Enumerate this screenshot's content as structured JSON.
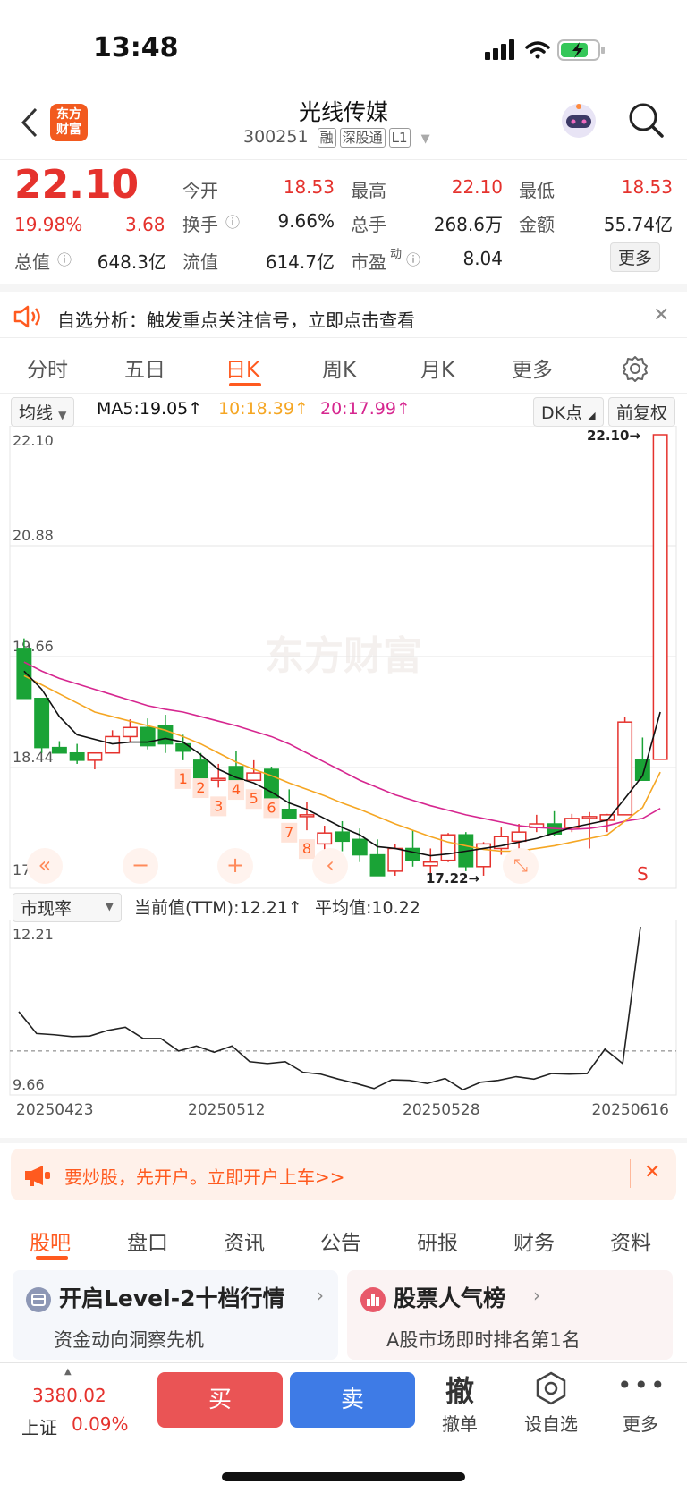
{
  "status": {
    "time": "13:48"
  },
  "header": {
    "logo_text": [
      "东方",
      "财富"
    ],
    "title": "光线传媒",
    "code": "300251",
    "tags": [
      "融",
      "深股通",
      "L1"
    ]
  },
  "quote": {
    "price": "22.10",
    "change_pct": "19.98%",
    "change": "3.68",
    "fields": [
      {
        "label": "今开",
        "value": "18.53",
        "color": "#e5322d"
      },
      {
        "label": "最高",
        "value": "22.10",
        "color": "#e5322d"
      },
      {
        "label": "最低",
        "value": "18.53",
        "color": "#e5322d"
      },
      {
        "label": "换手",
        "value": "9.66%",
        "color": "#222"
      },
      {
        "label": "总手",
        "value": "268.6万",
        "color": "#222"
      },
      {
        "label": "金额",
        "value": "55.74亿",
        "color": "#222"
      },
      {
        "label": "总值",
        "value": "648.3亿",
        "color": "#222"
      },
      {
        "label": "流值",
        "value": "614.7亿",
        "color": "#222"
      },
      {
        "label": "市盈",
        "value": "8.04",
        "color": "#222"
      }
    ],
    "pe_superscript": "动",
    "more_label": "更多"
  },
  "banner": {
    "text": "自选分析：触发重点关注信号，立即点击查看"
  },
  "tabs": [
    "分时",
    "五日",
    "日K",
    "周K",
    "月K",
    "更多"
  ],
  "active_tab": "日K",
  "ma": {
    "selector": "均线",
    "ma5": "MA5:19.05",
    "ma10": "10:18.39",
    "ma20": "20:17.99",
    "dk_label": "DK点",
    "adjust_label": "前复权"
  },
  "indicator": {
    "selector": "市现率",
    "current": "当前值(TTM):12.21",
    "average": "平均值:10.22"
  },
  "watermark": "东方财富",
  "ad": {
    "text": "要炒股，先开户。立即开户上车>>"
  },
  "subtabs": [
    "股吧",
    "盘口",
    "资讯",
    "公告",
    "研报",
    "财务",
    "资料"
  ],
  "cards": [
    {
      "title": "开启Level-2十档行情",
      "subtitle": "资金动向洞察先机"
    },
    {
      "title": "股票人气榜",
      "subtitle": "A股市场即时排名第1名"
    }
  ],
  "bottom": {
    "index_value": "3380.02",
    "index_name": "上证",
    "index_pct": "0.09%",
    "buy": "买",
    "sell": "卖",
    "cancel_glyph": "撤",
    "cancel": "撤单",
    "watch": "设自选",
    "more": "更多"
  },
  "colors": {
    "up": "#e5322d",
    "down": "#1aa336",
    "accent": "#ff5a1f",
    "ma5": "#111111",
    "ma10": "#f5a623",
    "ma20": "#d6268f"
  },
  "chart_data": [
    {
      "type": "candlestick",
      "y_axis_labels": [
        "22.10",
        "20.88",
        "19.66",
        "18.44",
        "17.22"
      ],
      "ylim": [
        17.22,
        22.1
      ],
      "ohlc": [
        [
          19.75,
          19.86,
          19.2,
          19.2
        ],
        [
          19.2,
          19.2,
          18.6,
          18.66
        ],
        [
          18.66,
          18.73,
          18.6,
          18.6
        ],
        [
          18.6,
          18.7,
          18.48,
          18.52
        ],
        [
          18.52,
          18.6,
          18.42,
          18.6
        ],
        [
          18.6,
          18.85,
          18.6,
          18.78
        ],
        [
          18.78,
          18.97,
          18.72,
          18.88
        ],
        [
          18.88,
          18.98,
          18.64,
          18.68
        ],
        [
          18.9,
          19.02,
          18.6,
          18.7
        ],
        [
          18.7,
          18.8,
          18.52,
          18.62
        ],
        [
          18.52,
          18.6,
          18.42,
          18.2
        ],
        [
          18.3,
          18.48,
          18.22,
          18.32
        ],
        [
          18.45,
          18.62,
          18.4,
          18.18
        ],
        [
          18.3,
          18.52,
          18.3,
          18.38
        ],
        [
          18.42,
          18.45,
          18.2,
          17.98
        ],
        [
          17.98,
          18.2,
          17.93,
          17.88
        ],
        [
          17.9,
          18.06,
          17.75,
          17.92
        ],
        [
          17.6,
          17.8,
          17.45,
          17.72
        ],
        [
          17.73,
          17.85,
          17.52,
          17.63
        ],
        [
          17.65,
          17.77,
          17.4,
          17.48
        ],
        [
          17.48,
          17.65,
          17.35,
          17.25
        ],
        [
          17.3,
          17.6,
          17.25,
          17.55
        ],
        [
          17.55,
          17.75,
          17.35,
          17.42
        ],
        [
          17.36,
          17.55,
          17.22,
          17.4
        ],
        [
          17.42,
          17.72,
          17.4,
          17.7
        ],
        [
          17.7,
          17.73,
          17.3,
          17.35
        ],
        [
          17.35,
          17.62,
          17.25,
          17.6
        ],
        [
          17.55,
          17.78,
          17.48,
          17.68
        ],
        [
          17.63,
          17.82,
          17.52,
          17.73
        ],
        [
          17.78,
          17.92,
          17.73,
          17.82
        ],
        [
          17.82,
          17.96,
          17.69,
          17.71
        ],
        [
          17.78,
          17.93,
          17.73,
          17.88
        ],
        [
          17.88,
          17.95,
          17.55,
          17.9
        ],
        [
          17.86,
          17.93,
          17.73,
          17.92
        ],
        [
          17.92,
          19.0,
          17.92,
          18.94
        ],
        [
          18.53,
          18.77,
          18.4,
          18.3
        ],
        [
          18.53,
          22.1,
          18.53,
          22.1
        ]
      ],
      "ma5": [
        19.5,
        19.3,
        19.0,
        18.8,
        18.75,
        18.7,
        18.72,
        18.72,
        18.76,
        18.72,
        18.58,
        18.42,
        18.33,
        18.27,
        18.17,
        18.05,
        17.98,
        17.88,
        17.78,
        17.7,
        17.57,
        17.55,
        17.51,
        17.47,
        17.49,
        17.52,
        17.55,
        17.58,
        17.62,
        17.66,
        17.72,
        17.78,
        17.82,
        17.86,
        18.1,
        18.35,
        19.05
      ],
      "ma10": [
        19.45,
        19.35,
        19.25,
        19.15,
        19.05,
        19.0,
        18.95,
        18.9,
        18.85,
        18.78,
        18.7,
        18.6,
        18.5,
        18.42,
        18.35,
        18.27,
        18.2,
        18.13,
        18.05,
        17.98,
        17.9,
        17.82,
        17.75,
        17.68,
        17.62,
        17.58,
        17.54,
        17.52,
        17.52,
        17.55,
        17.58,
        17.62,
        17.66,
        17.7,
        17.85,
        18.0,
        18.39
      ],
      "ma20": [
        19.6,
        19.5,
        19.42,
        19.36,
        19.3,
        19.24,
        19.18,
        19.12,
        19.08,
        19.05,
        19.0,
        18.95,
        18.9,
        18.84,
        18.78,
        18.7,
        18.6,
        18.5,
        18.4,
        18.3,
        18.22,
        18.14,
        18.08,
        18.02,
        17.97,
        17.92,
        17.88,
        17.84,
        17.8,
        17.78,
        17.77,
        17.76,
        17.77,
        17.8,
        17.85,
        17.88,
        17.99
      ],
      "up_marks": [
        {
          "i": 9,
          "text": "1"
        },
        {
          "i": 10,
          "text": "2"
        },
        {
          "i": 11,
          "text": "3"
        },
        {
          "i": 12,
          "text": "4"
        },
        {
          "i": 13,
          "text": "5"
        },
        {
          "i": 14,
          "text": "6"
        },
        {
          "i": 15,
          "text": "7"
        },
        {
          "i": 16,
          "text": "8"
        }
      ],
      "down_marks": [],
      "max_label": "22.10",
      "min_label": "17.22",
      "s_mark": "S"
    },
    {
      "type": "line",
      "series": [
        {
          "values": [
            10.85,
            10.5,
            10.48,
            10.45,
            10.46,
            10.55,
            10.6,
            10.42,
            10.42,
            10.22,
            10.3,
            10.2,
            10.3,
            10.05,
            10.02,
            10.05,
            9.88,
            9.85,
            9.77,
            9.7,
            9.62,
            9.76,
            9.75,
            9.7,
            9.78,
            9.6,
            9.72,
            9.75,
            9.81,
            9.77,
            9.86,
            9.85,
            9.86,
            10.25,
            10.02,
            12.21
          ]
        }
      ],
      "y_axis_labels": [
        "12.21",
        "9.66"
      ],
      "ylim": [
        9.66,
        12.21
      ],
      "average": 10.22,
      "x_labels": [
        "20250423",
        "20250512",
        "20250528",
        "20250616"
      ]
    }
  ]
}
